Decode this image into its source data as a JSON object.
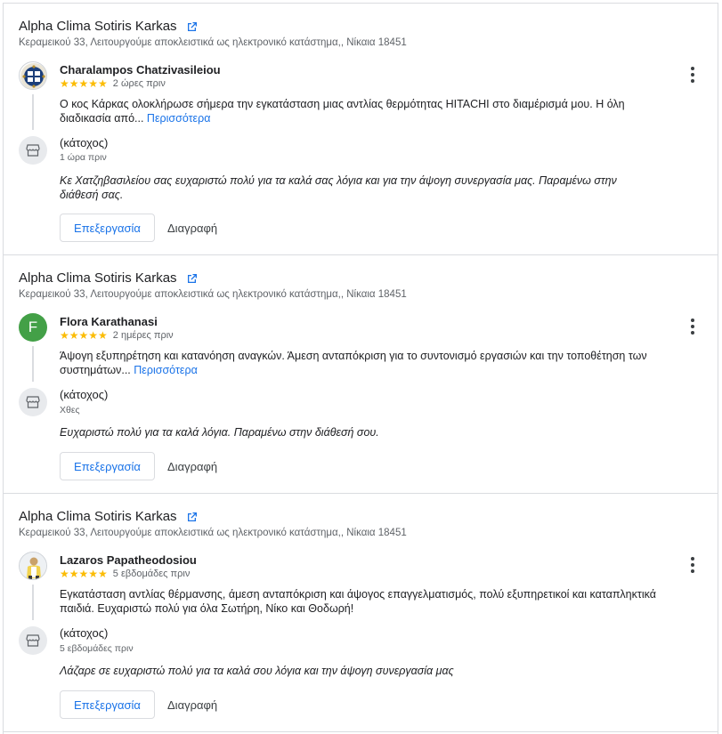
{
  "reviews": [
    {
      "business_name": "Alpha Clima Sotiris Karkas",
      "business_address": "Κεραμεικού 33, Λειτουργούμε αποκλειστικά ως ηλεκτρονικό κατάστημα,, Νίκαια 18451",
      "reviewer_name": "Charalampos Chatzivasileiou",
      "avatar": "crest-avatar",
      "rating": 5,
      "stars": "★★★★★",
      "time": "2 ώρες πριν",
      "text": "Ο κος Κάρκας ολοκλήρωσε σήμερα την εγκατάσταση μιας αντλίας θερμότητας HITACHI στο διαμέρισμά μου. Η όλη διαδικασία από...",
      "more": "Περισσότερα",
      "owner_label": "(κάτοχος)",
      "owner_time": "1 ώρα πριν",
      "reply": "Κε Χατζηβασιλείου σας ευχαριστώ πολύ για τα καλά σας λόγια και για την άψογη συνεργασία μας. Παραμένω στην διάθεσή σας.",
      "edit_label": "Επεξεργασία",
      "delete_label": "Διαγραφή"
    },
    {
      "business_name": "Alpha Clima Sotiris Karkas",
      "business_address": "Κεραμεικού 33, Λειτουργούμε αποκλειστικά ως ηλεκτρονικό κατάστημα,, Νίκαια 18451",
      "reviewer_name": "Flora Karathanasi",
      "avatar_letter": "F",
      "rating": 5,
      "stars": "★★★★★",
      "time": "2 ημέρες πριν",
      "text": "Άψογη εξυπηρέτηση και κατανόηση αναγκών. Άμεση ανταπόκριση για το συντονισμό εργασιών και την τοποθέτηση των συστημάτων...",
      "more": "Περισσότερα",
      "owner_label": "(κάτοχος)",
      "owner_time": "Χθες",
      "reply": "Ευχαριστώ πολύ για τα καλά λόγια. Παραμένω στην διάθεσή σου.",
      "edit_label": "Επεξεργασία",
      "delete_label": "Διαγραφή"
    },
    {
      "business_name": "Alpha Clima Sotiris Karkas",
      "business_address": "Κεραμεικού 33, Λειτουργούμε αποκλειστικά ως ηλεκτρονικό κατάστημα,, Νίκαια 18451",
      "reviewer_name": "Lazaros Papatheodosiou",
      "avatar": "photo-avatar",
      "rating": 5,
      "stars": "★★★★★",
      "time": "5 εβδομάδες πριν",
      "text": "Εγκατάσταση αντλίας θέρμανσης, άμεση ανταπόκριση και άψογος επαγγελματισμός, πολύ εξυπηρετικοί και καταπληκτικά παιδιά. Ευχαριστώ πολύ για όλα Σωτήρη, Νίκο και Θοδωρή!",
      "owner_label": "(κάτοχος)",
      "owner_time": "5 εβδομάδες πριν",
      "reply": "Λάζαρε σε ευχαριστώ πολύ για τα καλά σου λόγια και την άψογη συνεργασία μας",
      "edit_label": "Επεξεργασία",
      "delete_label": "Διαγραφή"
    }
  ],
  "colors": {
    "link": "#1a73e8",
    "star": "#fbbc04",
    "avatar_green": "#43a047",
    "divider": "#dadce0"
  },
  "icons": {
    "external": "open-in-new-icon",
    "owner": "storefront-icon",
    "menu": "more-vert-icon"
  }
}
